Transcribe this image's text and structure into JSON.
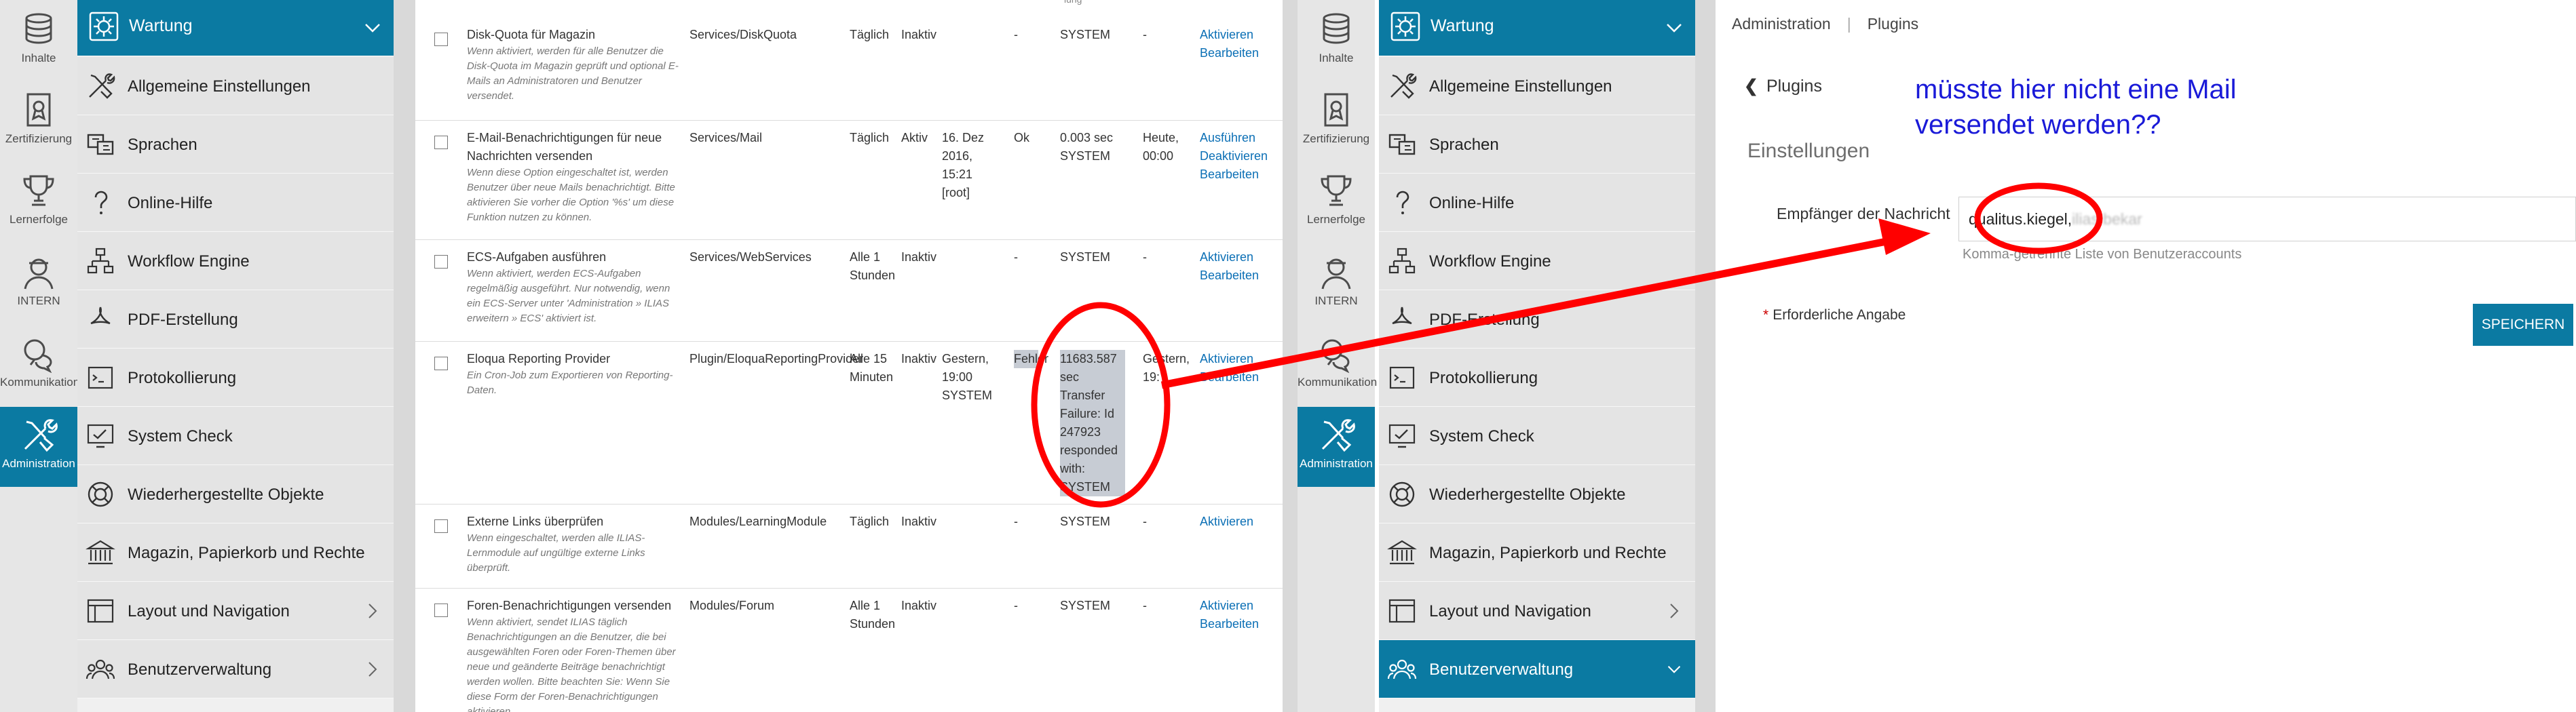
{
  "left": {
    "mainbar": [
      {
        "label": "Inhalte",
        "icon": "content-icon"
      },
      {
        "label": "Zertifizierung",
        "icon": "certificate-icon"
      },
      {
        "label": "Lernerfolge",
        "icon": "trophy-icon"
      },
      {
        "label": "INTERN",
        "icon": "user-internal-icon"
      },
      {
        "label": "Kommunikation",
        "icon": "chat-icon"
      },
      {
        "label": "Administration",
        "icon": "tools-icon",
        "active": true
      }
    ],
    "slate": {
      "header": "Wartung",
      "items": [
        "Allgemeine Einstellungen",
        "Sprachen",
        "Online-Hilfe",
        "Workflow Engine",
        "PDF-Erstellung",
        "Protokollierung",
        "System Check",
        "Wiederhergestellte Objekte",
        "Magazin, Papierkorb und Rechte",
        "Layout und Navigation",
        "Benutzerverwaltung"
      ]
    }
  },
  "right_sidebar": {
    "mainbar": [
      {
        "label": "Inhalte",
        "icon": "content-icon"
      },
      {
        "label": "Zertifizierung",
        "icon": "certificate-icon"
      },
      {
        "label": "Lernerfolge",
        "icon": "trophy-icon"
      },
      {
        "label": "INTERN",
        "icon": "user-internal-icon"
      },
      {
        "label": "Kommunikation",
        "icon": "chat-icon"
      },
      {
        "label": "Administration",
        "icon": "tools-icon",
        "active": true
      }
    ],
    "slate": {
      "header": "Wartung",
      "items": [
        "Allgemeine Einstellungen",
        "Sprachen",
        "Online-Hilfe",
        "Workflow Engine",
        "PDF-Erstellung",
        "Protokollierung",
        "System Check",
        "Wiederhergestellte Objekte",
        "Magazin, Papierkorb und Rechte",
        "Layout und Navigation",
        "Benutzerverwaltung"
      ]
    }
  },
  "cron_table": {
    "top_fragment": "lung",
    "rows": [
      {
        "title": "Disk-Quota für Magazin",
        "desc": "Wenn aktiviert, werden für alle Benutzer die Disk-Quota im Magazin geprüft und optional E-Mails an Administratoren und Benutzer versendet.",
        "component": "Services/DiskQuota",
        "schedule": "Täglich",
        "status": "Inaktiv",
        "last_run": "",
        "result": "-",
        "result_info": "SYSTEM",
        "duration": "-",
        "actions": [
          "Aktivieren",
          "Bearbeiten"
        ]
      },
      {
        "title": "E-Mail-Benachrichtigungen für neue Nachrichten versenden",
        "desc": "Wenn diese Option eingeschaltet ist, werden Benutzer über neue Mails benachrichtigt. Bitte aktivieren Sie vorher die Option '%s' um diese Funktion nutzen zu können.",
        "component": "Services/Mail",
        "schedule": "Täglich",
        "status": "Aktiv",
        "last_run": "16. Dez 2016, 15:21 [root]",
        "result": "Ok",
        "result_info": "0.003 sec SYSTEM",
        "duration": "Heute, 00:00",
        "actions": [
          "Ausführen",
          "Deaktivieren",
          "Bearbeiten"
        ]
      },
      {
        "title": "ECS-Aufgaben ausführen",
        "desc": "Wenn aktiviert, werden ECS-Aufgaben regelmäßig ausgeführt. Nur notwendig, wenn ein ECS-Server unter 'Administration » ILIAS erweitern » ECS' aktiviert ist.",
        "component": "Services/WebServices",
        "schedule": "Alle 1 Stunden",
        "status": "Inaktiv",
        "last_run": "",
        "result": "-",
        "result_info": "SYSTEM",
        "duration": "-",
        "actions": [
          "Aktivieren",
          "Bearbeiten"
        ]
      },
      {
        "title": "Eloqua Reporting Provider",
        "desc": "Ein Cron-Job zum Exportieren von Reporting-Daten.",
        "component": "Plugin/EloquaReportingProvider",
        "schedule": "Alle 15 Minuten",
        "status": "Inaktiv",
        "last_run": "Gestern, 19:00 SYSTEM",
        "result": "Fehler",
        "result_info": "11683.587 sec Transfer Failure: Id 247923 responded with: SYSTEM",
        "duration": "Gestern, 19:",
        "actions": [
          "Aktivieren",
          "Bearbeiten"
        ]
      },
      {
        "title": "Externe Links überprüfen",
        "desc": "Wenn eingeschaltet, werden alle ILIAS-Lernmodule auf ungültige externe Links überprüft.",
        "component": "Modules/LearningModule",
        "schedule": "Täglich",
        "status": "Inaktiv",
        "last_run": "",
        "result": "-",
        "result_info": "SYSTEM",
        "duration": "-",
        "actions": [
          "Aktivieren"
        ]
      },
      {
        "title": "Foren-Benachrichtigungen versenden",
        "desc": "Wenn aktiviert, sendet ILIAS täglich Benachrichtigungen an die Benutzer, die bei ausgewählten Foren oder Foren-Themen über neue und geänderte Beiträge benachrichtigt werden wollen. Bitte beachten Sie: Wenn Sie diese Form der Foren-Benachrichtigungen aktivieren,",
        "component": "Modules/Forum",
        "schedule": "Alle 1 Stunden",
        "status": "Inaktiv",
        "last_run": "",
        "result": "-",
        "result_info": "SYSTEM",
        "duration": "-",
        "actions": [
          "Aktivieren",
          "Bearbeiten"
        ]
      }
    ]
  },
  "plugin_page": {
    "breadcrumb": [
      "Administration",
      "Plugins"
    ],
    "back_label": "Plugins",
    "section_title": "Einstellungen",
    "field_label": "Empfänger der Nachricht",
    "field_value": "qualitus.kiegel,",
    "field_value_blurred": "ilias.bekar",
    "field_help": "Komma-getrennte Liste von Benutzeraccounts",
    "required_note": "Erforderliche Angabe",
    "save_button": "SPEICHERN"
  },
  "annotation": {
    "note": "müsste hier nicht eine Mail versendet werden??",
    "color": "#ff0000",
    "note_color": "#1a1ad8"
  },
  "colors": {
    "accent": "#0b7aa2",
    "link": "#0b6fb5"
  }
}
